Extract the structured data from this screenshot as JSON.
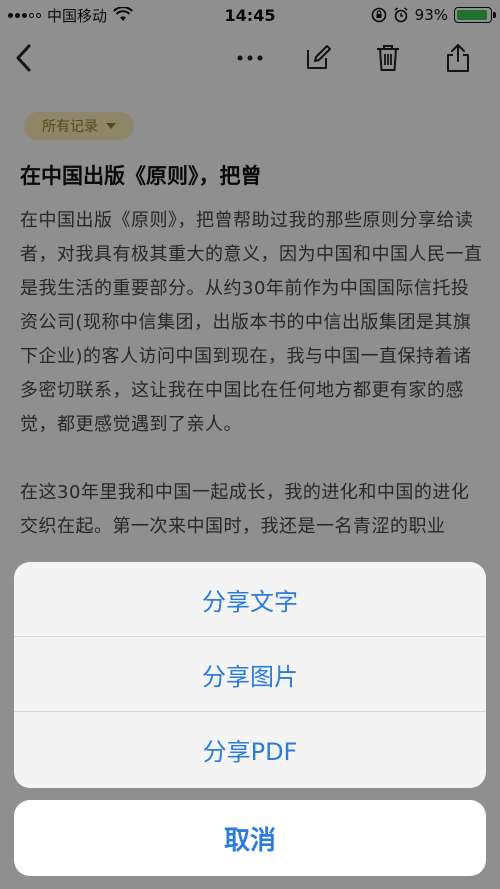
{
  "status_bar": {
    "carrier": "中国移动",
    "time": "14:45",
    "battery_percent": "93%",
    "battery_level": 0.93
  },
  "nav_bar": {
    "icons": [
      "back-arrow-icon",
      "more-dots-icon",
      "edit-icon",
      "trash-icon",
      "share-icon"
    ]
  },
  "filter": {
    "label": "所有记录"
  },
  "article": {
    "title": "在中国出版《原则》，把曾",
    "paragraphs": [
      "在中国出版《原则》，把曾帮助过我的那些原则分享给读者，对我具有极其重大的意义，因为中国和中国人民一直是我生活的重要部分。从约30年前作为中国国际信托投资公司(现称中信集团，出版本书的中信出版集团是其旗下企业)的客人访问中国到现在，我与中国一直保持着诸多密切联系，这让我在中国比在任何地方都更有家的感觉，都更感觉遇到了亲人。",
      "在这30年里我和中国一起成长，我的进化和中国的进化交织在起。第一次来中国时，我还是一名青涩的职业"
    ]
  },
  "action_sheet": {
    "share_text": "分享文字",
    "share_image": "分享图片",
    "share_pdf": "分享PDF",
    "cancel": "取消"
  },
  "colors": {
    "accent": "#2b7bd8",
    "battery": "#3cc14e",
    "chip_bg": "#f3e7b4",
    "chip_text": "#9b7a2e"
  }
}
